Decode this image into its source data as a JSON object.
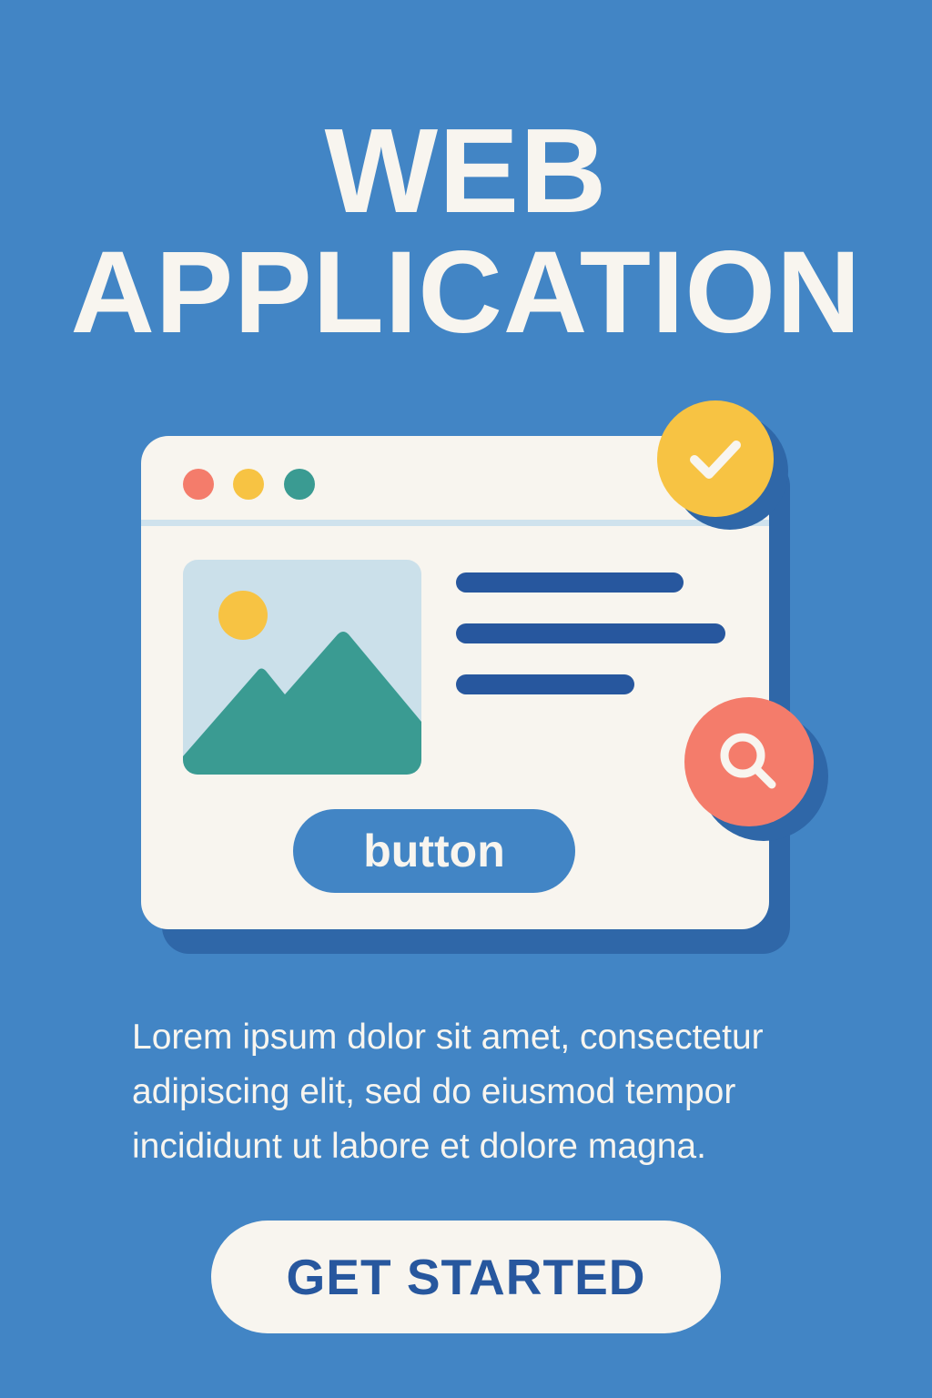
{
  "hero": {
    "title_line1": "WEB",
    "title_line2": "APPLICATION"
  },
  "mockup": {
    "window_dots": [
      "red",
      "yellow",
      "green"
    ],
    "image_icon": "mountain-landscape-icon",
    "button_label": "button",
    "badges": [
      "checkmark-icon",
      "search-icon"
    ]
  },
  "description": "Lorem ipsum dolor sit amet, consectetur adipiscing elit, sed do eiusmod tempor incididunt ut labore et dolore magna.",
  "cta": {
    "label": "GET STARTED"
  },
  "colors": {
    "background": "#4285c5",
    "cream": "#f8f5ef",
    "navy": "#27579e",
    "yellow": "#f7c343",
    "coral": "#f47c6b",
    "teal": "#3a9b92",
    "light_blue": "#cbe0ea"
  }
}
